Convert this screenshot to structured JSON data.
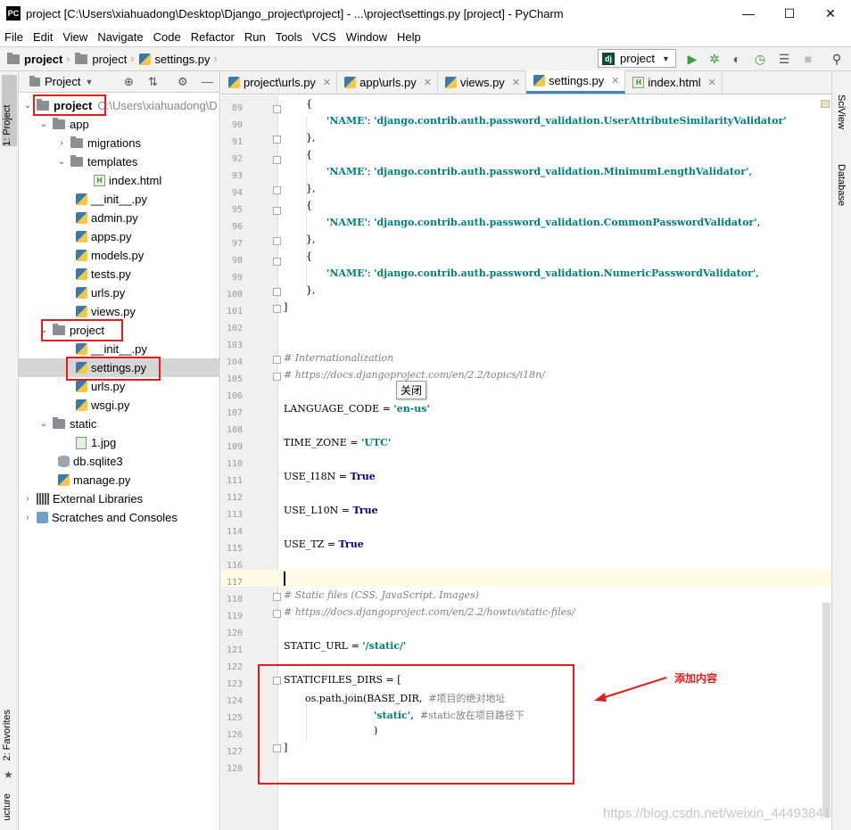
{
  "window": {
    "title": "project [C:\\Users\\xiahuadong\\Desktop\\Django_project\\project] - ...\\project\\settings.py [project] - PyCharm",
    "app_icon": "PC",
    "min_glyph": "—",
    "max_glyph": "☐",
    "close_glyph": "✕"
  },
  "menu": [
    "File",
    "Edit",
    "View",
    "Navigate",
    "Code",
    "Refactor",
    "Run",
    "Tools",
    "VCS",
    "Window",
    "Help"
  ],
  "breadcrumbs": [
    "project",
    "project",
    "settings.py"
  ],
  "run_config": {
    "icon": "dj",
    "label": "project"
  },
  "left_stripe": {
    "project_tab": "1: Project",
    "favorites_tab": "2: Favorites",
    "structure_tab": "ucture"
  },
  "right_stripe": {
    "sciview_tab": "SciView",
    "database_tab": "Database"
  },
  "project_panel": {
    "header": "Project",
    "tree": [
      {
        "label": "project",
        "hint": "C:\\Users\\xiahuadong\\D",
        "bold": true
      },
      {
        "label": "app"
      },
      {
        "label": "migrations"
      },
      {
        "label": "templates"
      },
      {
        "label": "index.html"
      },
      {
        "label": "__init__.py"
      },
      {
        "label": "admin.py"
      },
      {
        "label": "apps.py"
      },
      {
        "label": "models.py"
      },
      {
        "label": "tests.py"
      },
      {
        "label": "urls.py"
      },
      {
        "label": "views.py"
      },
      {
        "label": "project"
      },
      {
        "label": "__init__.py"
      },
      {
        "label": "settings.py"
      },
      {
        "label": "urls.py"
      },
      {
        "label": "wsgi.py"
      },
      {
        "label": "static"
      },
      {
        "label": "1.jpg"
      },
      {
        "label": "db.sqlite3"
      },
      {
        "label": "manage.py"
      },
      {
        "label": "External Libraries"
      },
      {
        "label": "Scratches and Consoles"
      }
    ]
  },
  "editor_tabs": [
    {
      "label": "project\\urls.py",
      "icon": "python-file-icon",
      "active": false
    },
    {
      "label": "app\\urls.py",
      "icon": "python-file-icon",
      "active": false
    },
    {
      "label": "views.py",
      "icon": "python-file-icon",
      "active": false
    },
    {
      "label": "settings.py",
      "icon": "python-file-icon",
      "active": true
    },
    {
      "label": "index.html",
      "icon": "html-file-icon",
      "active": false
    }
  ],
  "editor": {
    "line_numbers": [
      "89",
      "90",
      "91",
      "92",
      "93",
      "94",
      "95",
      "96",
      "97",
      "98",
      "99",
      "100",
      "101",
      "102",
      "103",
      "104",
      "105",
      "106",
      "107",
      "108",
      "109",
      "110",
      "111",
      "112",
      "113",
      "114",
      "115",
      "116",
      "117",
      "118",
      "119",
      "120",
      "121",
      "122",
      "123",
      "124",
      "125",
      "126",
      "127",
      "128"
    ],
    "code": {
      "l89": "{",
      "l90_key": "'NAME'",
      "l90_val": "'django.contrib.auth.password_validation.UserAttributeSimilarityValidator'",
      "l91": "},",
      "l92": "{",
      "l93_key": "'NAME'",
      "l93_val": "'django.contrib.auth.password_validation.MinimumLengthValidator'",
      "l94": "},",
      "l95": "{",
      "l96_key": "'NAME'",
      "l96_val": "'django.contrib.auth.password_validation.CommonPasswordValidator'",
      "l97": "},",
      "l98": "{",
      "l99_key": "'NAME'",
      "l99_val": "'django.contrib.auth.password_validation.NumericPasswordValidator'",
      "l100": "},",
      "l101": "]",
      "l104": "# Internationalization",
      "l105": "# https://docs.djangoproject.com/en/2.2/topics/i18n/",
      "l107_name": "LANGUAGE_CODE = ",
      "l107_val": "'en-us'",
      "l109_name": "TIME_ZONE = ",
      "l109_val": "'UTC'",
      "l111_name": "USE_I18N = ",
      "l111_val": "True",
      "l113_name": "USE_L10N = ",
      "l113_val": "True",
      "l115_name": "USE_TZ = ",
      "l115_val": "True",
      "l118": "# Static files (CSS, JavaScript, Images)",
      "l119": "# https://docs.djangoproject.com/en/2.2/howto/static-files/",
      "l121_name": "STATIC_URL = ",
      "l121_val": "'/static/'",
      "l123": "STATICFILES_DIRS = [",
      "l124_code": "os.path.join(BASE_DIR,",
      "l124_cmt": "#项目的绝对地址",
      "l125_val": "'static',",
      "l125_cmt": "#static放在项目路径下",
      "l126": ")",
      "l127": "]"
    },
    "tooltip": "关闭"
  },
  "annotation": {
    "label": "添加内容",
    "color": "#e51c1c"
  },
  "watermark": "https://blog.csdn.net/weixin_44493841",
  "colors": {
    "accent": "#4083c9",
    "string": "#008080",
    "keyword": "#000080",
    "comment": "#808080",
    "annotation_red": "#e51c1c"
  }
}
